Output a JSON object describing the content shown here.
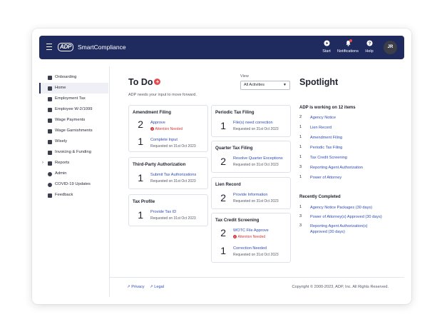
{
  "header": {
    "logo": "ADP",
    "app_name": "SmartCompliance",
    "start_label": "Start",
    "notifications_label": "Notifications",
    "help_label": "Help",
    "avatar_initials": "JR"
  },
  "sidebar": {
    "items": [
      {
        "label": "Onboarding",
        "icon": "grid-icon"
      },
      {
        "label": "Home",
        "icon": "home-icon",
        "active": true
      },
      {
        "label": "Employment Tax",
        "icon": "briefcase-icon"
      },
      {
        "label": "Employee W-2/1099",
        "icon": "document-icon"
      },
      {
        "label": "Wage Payments",
        "icon": "card-icon"
      },
      {
        "label": "Wage Garnishments",
        "icon": "garnish-icon"
      },
      {
        "label": "Wisely",
        "icon": "wallet-icon"
      },
      {
        "label": "Invoicing & Funding",
        "icon": "invoice-icon"
      },
      {
        "label": "Reports",
        "icon": "report-icon"
      },
      {
        "label": "Admin",
        "icon": "gear-icon"
      },
      {
        "label": "COVID-19 Updates",
        "icon": "globe-icon"
      },
      {
        "label": "Feedback",
        "icon": "chat-icon"
      }
    ]
  },
  "todo": {
    "title": "To Do",
    "subtitle": "ADP needs your input to move forward.",
    "view_label": "View",
    "view_value": "All Activities",
    "cards": {
      "amendment": {
        "title": "Amendment Filing",
        "rows": [
          {
            "count": "2",
            "link": "Approve",
            "alert": "Attention Needed"
          },
          {
            "count": "1",
            "link": "Complete Input",
            "meta": "Requested on 31st Oct 2023"
          }
        ]
      },
      "third_party": {
        "title": "Third-Party Authorization",
        "rows": [
          {
            "count": "1",
            "link": "Submit Tax Authorizations",
            "meta": "Requested on 31st Oct 2023"
          }
        ]
      },
      "tax_profile": {
        "title": "Tax Profile",
        "rows": [
          {
            "count": "1",
            "link": "Provide Tax ID",
            "meta": "Requested on 31st Oct 2023"
          }
        ]
      },
      "periodic": {
        "title": "Periodic Tax Filing",
        "rows": [
          {
            "count": "1",
            "link": "File(s) need correction",
            "meta": "Requested on 31st Oct 2023"
          }
        ]
      },
      "quarter": {
        "title": "Quarter Tax Filing",
        "rows": [
          {
            "count": "2",
            "link": "Resolve Quarter Exceptions",
            "meta": "Requested on 31st Oct 2023"
          }
        ]
      },
      "lien": {
        "title": "Lien Record",
        "rows": [
          {
            "count": "2",
            "link": "Provide Information",
            "meta": "Requested on 31st Oct 2023"
          }
        ]
      },
      "credit": {
        "title": "Tax Credit Screening",
        "rows": [
          {
            "count": "2",
            "link": "WOTC File Approve",
            "alert": "Attention Needed"
          },
          {
            "count": "1",
            "link": "Correction Needed",
            "meta": "Requested on 31st Oct 2023"
          }
        ]
      }
    }
  },
  "spotlight": {
    "title": "Spotlight",
    "working_heading": "ADP is working on 12 items",
    "working": [
      {
        "count": "2",
        "label": "Agency Notice"
      },
      {
        "count": "1",
        "label": "Lien Record"
      },
      {
        "count": "1",
        "label": "Amendment Filing"
      },
      {
        "count": "1",
        "label": "Periodic Tax Filing"
      },
      {
        "count": "1",
        "label": "Tax Credit Screening"
      },
      {
        "count": "3",
        "label": "Reporting Agent Authorization"
      },
      {
        "count": "1",
        "label": "Power of Attorney"
      }
    ],
    "completed_heading": "Recently Completed",
    "completed": [
      {
        "count": "1",
        "label": "Agency Notice Packages (30 days)"
      },
      {
        "count": "3",
        "label": "Power of Attorney(s) Approved (30 days)"
      },
      {
        "count": "3",
        "label": "Reporting Agent Authorization(s) Approved (30 days)"
      }
    ]
  },
  "footer": {
    "privacy": "Privacy",
    "legal": "Legal",
    "copyright": "Copyright © 2000-2023, ADP, Inc. All Rights Reserved."
  },
  "colors": {
    "header_bg": "#1f2a5e",
    "link": "#2f4db8",
    "alert": "#d23b3b",
    "accent": "#e5484d"
  }
}
